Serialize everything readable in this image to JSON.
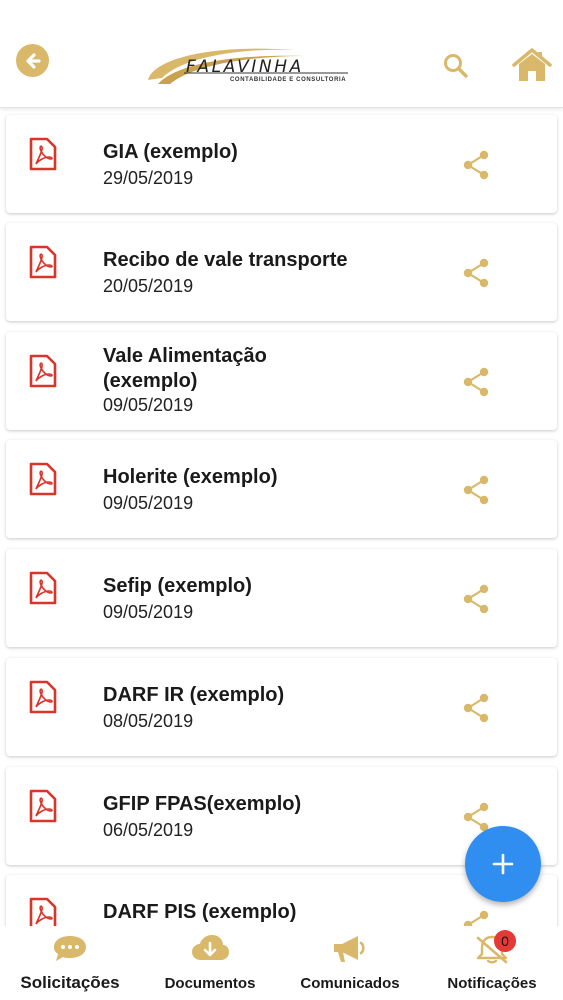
{
  "header": {
    "logo": {
      "name": "FALAVINHA",
      "subtitle": "CONTABILIDADE E CONSULTORIA"
    },
    "icons": {
      "back": "arrow-left-icon",
      "search": "search-icon",
      "home": "home-icon"
    }
  },
  "documents": [
    {
      "title": "GIA (exemplo)",
      "date": "29/05/2019"
    },
    {
      "title": "Recibo de vale transporte",
      "date": "20/05/2019"
    },
    {
      "title": "Vale Alimentação (exemplo)",
      "date": "09/05/2019"
    },
    {
      "title": "Holerite (exemplo)",
      "date": "09/05/2019"
    },
    {
      "title": "Sefip (exemplo)",
      "date": "09/05/2019"
    },
    {
      "title": "DARF IR (exemplo)",
      "date": "08/05/2019"
    },
    {
      "title": "GFIP FPAS(exemplo)",
      "date": "06/05/2019"
    },
    {
      "title": "DARF PIS (exemplo)",
      "date": ""
    }
  ],
  "fab": {
    "icon": "plus-icon"
  },
  "bottom_nav": [
    {
      "label": "Solicitações",
      "icon": "chat-bubble-icon",
      "active": true
    },
    {
      "label": "Documentos",
      "icon": "cloud-download-icon",
      "active": false
    },
    {
      "label": "Comunicados",
      "icon": "megaphone-icon",
      "active": false
    },
    {
      "label": "Notificações",
      "icon": "bell-off-icon",
      "badge": "0",
      "active": false
    }
  ],
  "colors": {
    "gold": "#d9b86a",
    "pdf_red": "#d9352b",
    "fab_blue": "#2f8ef0",
    "badge_red": "#e53935"
  }
}
